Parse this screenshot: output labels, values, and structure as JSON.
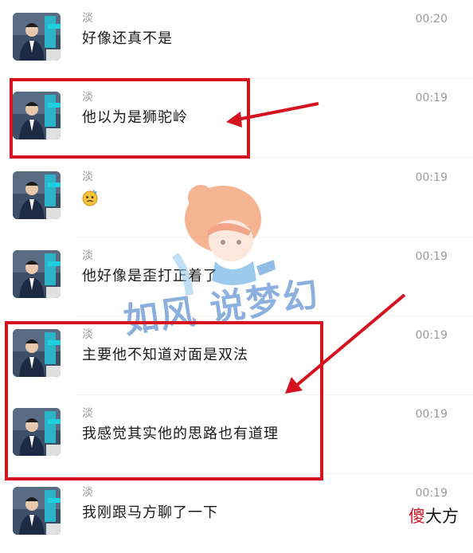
{
  "messages": [
    {
      "sender": "淡",
      "text": "好像还真不是",
      "time": "00:20"
    },
    {
      "sender": "淡",
      "text": "他以为是狮驼岭",
      "time": "00:19"
    },
    {
      "sender": "淡",
      "text": "",
      "time": "00:19",
      "sticker_icon": "worried-emoji-sticker-icon"
    },
    {
      "sender": "淡",
      "text": "他好像是歪打正着了",
      "time": "00:19"
    },
    {
      "sender": "淡",
      "text": "主要他不知道对面是双法",
      "time": "00:19"
    },
    {
      "sender": "淡",
      "text": "我感觉其实他的思路也有道理",
      "time": "00:19"
    },
    {
      "sender": "淡",
      "text": "我刚跟马方聊了一下",
      "time": "00:19"
    }
  ],
  "watermark": {
    "text": "如风 说梦幻"
  },
  "corner_logo": {
    "accent": "傻",
    "rest": "大方"
  },
  "colors": {
    "highlight": "#d6121e",
    "muted_text": "#9a9a9a",
    "body_text": "#1a1a1a"
  }
}
